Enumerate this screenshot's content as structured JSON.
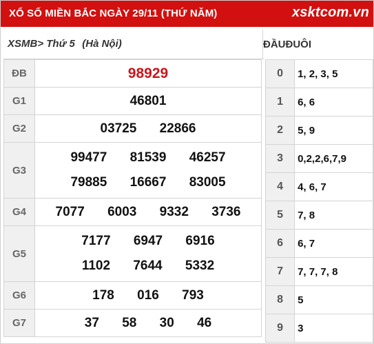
{
  "header": {
    "title": "XỔ SỐ MIỀN BẮC NGÀY 29/11 (THỨ NĂM)",
    "logo": "xsktcom.vn"
  },
  "subheader": {
    "nav": "XSMB> Thứ 5",
    "location": "(Hà Nội)",
    "dau_label": "ĐẦU",
    "duoi_label": "ĐUÔI"
  },
  "prizes": [
    {
      "label": "ĐB",
      "rows": [
        [
          "98929"
        ]
      ]
    },
    {
      "label": "G1",
      "rows": [
        [
          "46801"
        ]
      ]
    },
    {
      "label": "G2",
      "rows": [
        [
          "03725",
          "22866"
        ]
      ]
    },
    {
      "label": "G3",
      "rows": [
        [
          "99477",
          "81539",
          "46257"
        ],
        [
          "79885",
          "16667",
          "83005"
        ]
      ]
    },
    {
      "label": "G4",
      "rows": [
        [
          "7077",
          "6003",
          "9332",
          "3736"
        ]
      ]
    },
    {
      "label": "G5",
      "rows": [
        [
          "7177",
          "6947",
          "6916"
        ],
        [
          "1102",
          "7644",
          "5332"
        ]
      ]
    },
    {
      "label": "G6",
      "rows": [
        [
          "178",
          "016",
          "793"
        ]
      ]
    },
    {
      "label": "G7",
      "rows": [
        [
          "37",
          "58",
          "30",
          "46"
        ]
      ]
    }
  ],
  "loto": [
    {
      "dau": "0",
      "duoi": "1, 2, 3, 5"
    },
    {
      "dau": "1",
      "duoi": "6, 6"
    },
    {
      "dau": "2",
      "duoi": "5, 9"
    },
    {
      "dau": "3",
      "duoi": "0,2,2,6,7,9"
    },
    {
      "dau": "4",
      "duoi": "4, 6, 7"
    },
    {
      "dau": "5",
      "duoi": "7, 8"
    },
    {
      "dau": "6",
      "duoi": "6, 7"
    },
    {
      "dau": "7",
      "duoi": "7, 7, 7, 8"
    },
    {
      "dau": "8",
      "duoi": "5"
    },
    {
      "dau": "9",
      "duoi": "3"
    }
  ],
  "colors": {
    "header_bg": "#d1100f",
    "special_prize": "#c8161d",
    "label_bg": "#f0f0f0"
  }
}
